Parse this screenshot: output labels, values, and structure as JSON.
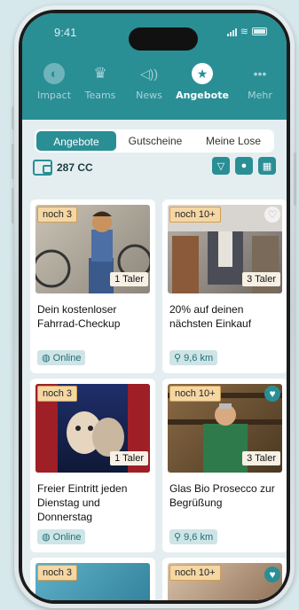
{
  "status": {
    "time": "9:41"
  },
  "nav": [
    {
      "label": "Impact",
      "icon": "globe-icon"
    },
    {
      "label": "Teams",
      "icon": "trophy-icon"
    },
    {
      "label": "News",
      "icon": "megaphone-icon"
    },
    {
      "label": "Angebote",
      "icon": "star-icon"
    },
    {
      "label": "Mehr",
      "icon": "more-icon"
    }
  ],
  "segments": [
    "Angebote",
    "Gutscheine",
    "Meine Lose"
  ],
  "credits": {
    "value": "287 CC"
  },
  "offers": [
    {
      "badge": "noch 3",
      "price": "1 Taler",
      "title": "Dein kostenloser Fahrrad-Checkup",
      "location": "Online",
      "favorite": false
    },
    {
      "badge": "noch 10+",
      "price": "3 Taler",
      "title": "20% auf deinen nächsten Einkauf",
      "location": "9,6 km",
      "favorite": false
    },
    {
      "badge": "noch 3",
      "price": "1 Taler",
      "title": "Freier Eintritt jeden Dienstag und Donnerstag",
      "location": "Online",
      "favorite": false
    },
    {
      "badge": "noch 10+",
      "price": "3 Taler",
      "title": "Glas Bio Prosecco zur Begrüßung",
      "location": "9,6 km",
      "favorite": true
    },
    {
      "badge": "noch 3"
    },
    {
      "badge": "noch 10+"
    }
  ],
  "colors": {
    "teal": "#2a8e95",
    "badge": "#f5d7a4"
  }
}
